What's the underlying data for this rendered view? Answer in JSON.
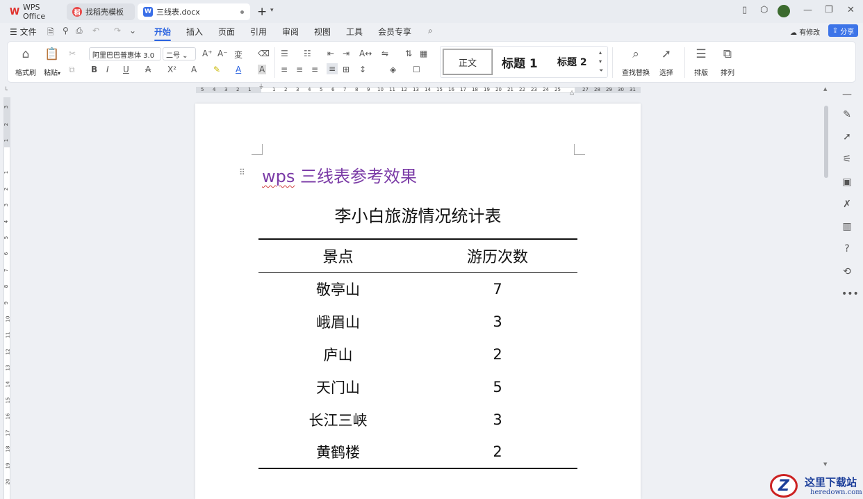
{
  "tabs": [
    {
      "label": "WPS Office",
      "icon": "wps-logo-icon"
    },
    {
      "label": "找稻壳模板",
      "icon": "docer-icon"
    },
    {
      "label": "三线表.docx",
      "icon": "word-doc-icon",
      "active": true
    }
  ],
  "menu": {
    "file": "文件",
    "items": [
      "开始",
      "插入",
      "页面",
      "引用",
      "审阅",
      "视图",
      "工具",
      "会员专享"
    ],
    "active": "开始",
    "revise": "有修改",
    "share": "分享"
  },
  "ribbon": {
    "format_painter": "格式刷",
    "paste": "粘贴",
    "font_name": "阿里巴巴普惠体 3.0",
    "font_size": "二号",
    "styles": {
      "normal": "正文",
      "heading1": "标题 1",
      "heading2": "标题 2"
    },
    "find_replace": "查找替换",
    "select": "选择",
    "layout": "排版",
    "arrange": "排列"
  },
  "ruler": {
    "h_left": [
      "5",
      "4",
      "3",
      "2",
      "1"
    ],
    "h_right": [
      "1",
      "2",
      "3",
      "4",
      "5",
      "6",
      "7",
      "8",
      "9",
      "10",
      "11",
      "12",
      "13",
      "14",
      "15",
      "16",
      "17",
      "18",
      "19",
      "20",
      "21",
      "22",
      "23",
      "24",
      "25",
      "26",
      "27",
      "28",
      "29",
      "30",
      "31"
    ],
    "v_top": [
      "3",
      "2",
      "1"
    ],
    "v_main": [
      "1",
      "2",
      "3",
      "4",
      "5",
      "6",
      "7",
      "8",
      "9",
      "10",
      "11",
      "12",
      "13",
      "14",
      "15",
      "16",
      "17",
      "18",
      "19",
      "20"
    ]
  },
  "document": {
    "heading_wavy": "wps",
    "heading_rest": " 三线表参考效果",
    "table_title": "李小白旅游情况统计表",
    "headers": [
      "景点",
      "游历次数"
    ],
    "rows": [
      [
        "敬亭山",
        "7"
      ],
      [
        "峨眉山",
        "3"
      ],
      [
        "庐山",
        "2"
      ],
      [
        "天门山",
        "5"
      ],
      [
        "长江三峡",
        "3"
      ],
      [
        "黄鹤楼",
        "2"
      ]
    ]
  },
  "watermark": {
    "cn": "这里下载站",
    "en": "heredown.com",
    "logo": "Z"
  },
  "colors": {
    "accent": "#2a63e0",
    "heading_purple": "#7a3aa6",
    "share_blue": "#3d74e8"
  }
}
